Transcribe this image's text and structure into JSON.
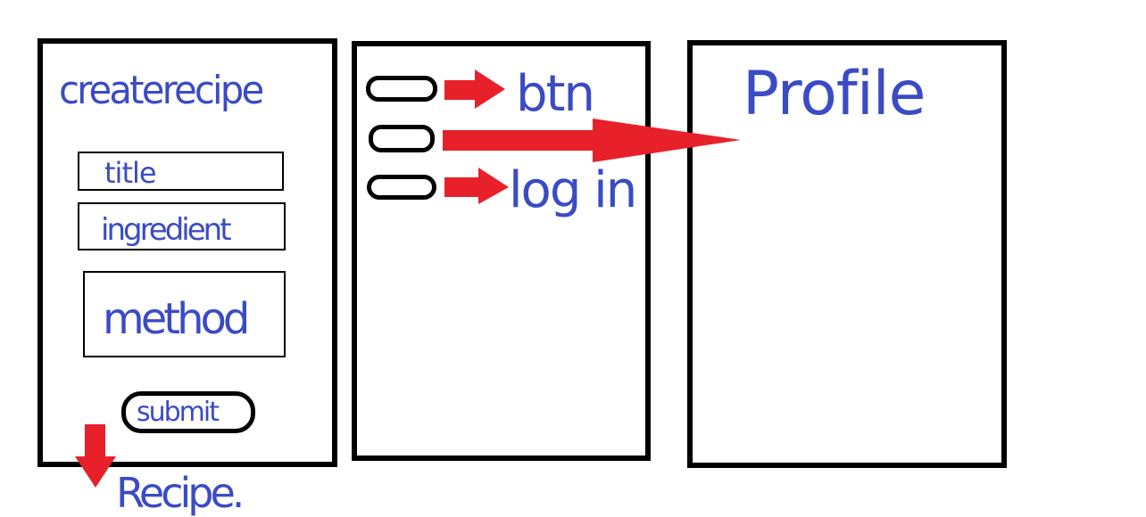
{
  "colors": {
    "ink": "#000000",
    "handwriting": "#3a4bc4",
    "arrow": "#e8202a"
  },
  "create_recipe_screen": {
    "title": "createrecipe",
    "fields": {
      "title_label": "title",
      "ingredient_label": "ingredient",
      "method_label": "method"
    },
    "submit_label": "submit"
  },
  "flow_note": "Recipe.",
  "menu_screen": {
    "button_note": "btn",
    "login_note": "log in"
  },
  "profile_screen": {
    "title": "Profile"
  }
}
